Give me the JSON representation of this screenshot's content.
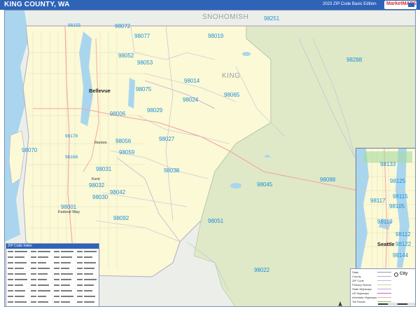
{
  "header": {
    "title": "KING COUNTY, WA",
    "edition": "2023 ZIP Code Basic Edition"
  },
  "brand": {
    "logo_text": "MarketMAPS"
  },
  "colors": {
    "title_bar": "#2e63b8",
    "county_fill": "#fbf9d6",
    "forest_fill": "#dfe9c8",
    "water": "#a9d6ee",
    "zip_label": "#1e8fd6",
    "county_boundary": "#b5a8c9"
  },
  "map": {
    "region_labels": [
      "SNOHOMISH",
      "KING"
    ],
    "zip_labels": [
      "98251",
      "98155",
      "98072",
      "98077",
      "98019",
      "98052",
      "98053",
      "98014",
      "98075",
      "98065",
      "98024",
      "98029",
      "98006",
      "98027",
      "98056",
      "98059",
      "98070",
      "98178",
      "98168",
      "98032",
      "98031",
      "98030",
      "98042",
      "98038",
      "98092",
      "98022",
      "98051",
      "98045",
      "98288",
      "98088",
      "98001"
    ],
    "city_labels": [
      "Bellevue",
      "Renton",
      "Kent",
      "Federal Way"
    ]
  },
  "inset": {
    "zip_labels": [
      "98133",
      "98125",
      "98117",
      "98105",
      "98115",
      "98119",
      "98112",
      "98144",
      "98122"
    ],
    "city_label": "Seattle"
  },
  "zip_table": {
    "header": "ZIP Code Index"
  },
  "legend": {
    "items": [
      "State",
      "County",
      "ZIP Code",
      "Primary Streets",
      "State Highways",
      "US Highways",
      "Interstate Highways",
      "Toll Roads"
    ],
    "city_label": "City"
  }
}
